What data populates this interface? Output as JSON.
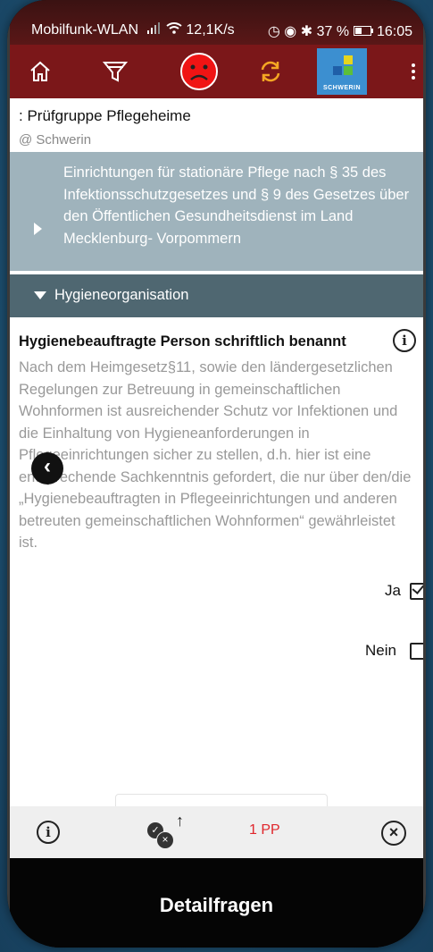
{
  "status": {
    "network": "Mobilfunk-WLAN",
    "speed": "12,1K/s",
    "battery": "37 %",
    "time": "16:05"
  },
  "toolbar": {
    "logo_text": "SCHWERIN"
  },
  "header": {
    "title": ": Prüfgruppe Pflegeheime",
    "location": "@ Schwerin"
  },
  "banner": {
    "text": "Einrichtungen für stationäre Pflege nach § 35 des Infektionsschutzgesetzes und § 9 des Gesetzes über den Öffentlichen Gesundheitsdienst im Land Mecklenburg- Vorpommern"
  },
  "section": {
    "title": "Hygieneorganisation"
  },
  "question": {
    "title": "Hygienebeauftragte Person schriftlich benannt",
    "body": "Nach dem Heimgesetz§11, sowie den ländergesetzlichen Regelungen zur Betreuung in gemeinschaftlichen Wohnformen ist ausreichender Schutz vor Infektionen und die Einhaltung von Hygieneanforderungen in Pflegeeinrichtungen sicher zu stellen, d.h. hier ist eine entsprechende Sachkenntnis gefordert, die nur über den/die „Hygienebeauftragten in Pflegeeinrichtungen und anderen betreuten gemeinschaftlichen Wohnformen“ gewährleistet ist.",
    "options": [
      {
        "label": "Ja",
        "checked": true
      },
      {
        "label": "Nein",
        "checked": false
      }
    ]
  },
  "bottombar": {
    "pp": "1 PP"
  },
  "nav": {
    "label": "Detailfragen"
  }
}
